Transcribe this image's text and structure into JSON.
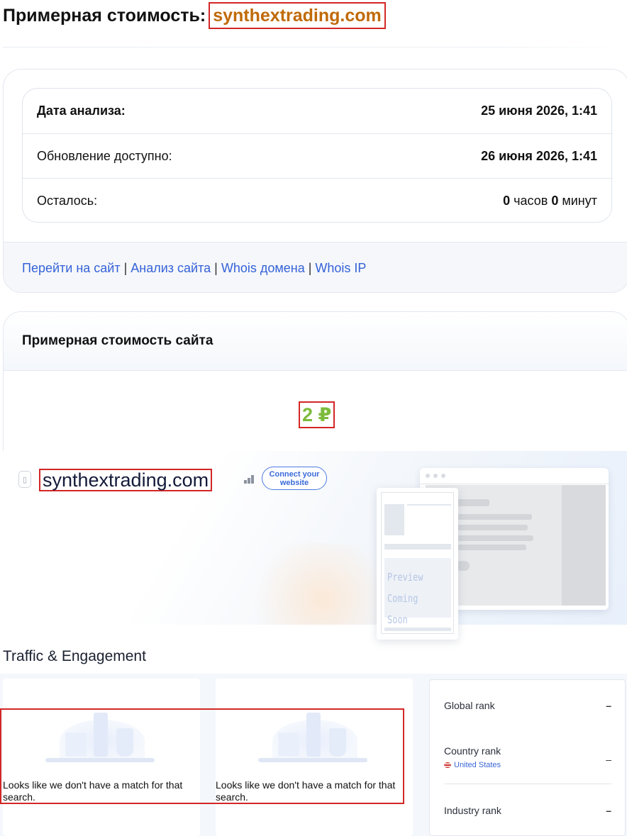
{
  "header": {
    "title": "Примерная стоимость:",
    "domain": "synthextrading.com"
  },
  "analysis": {
    "date_label": "Дата анализа:",
    "date_value": "25 июня 2026, 1:41",
    "update_label": "Обновление доступно:",
    "update_value": "26 июня 2026, 1:41",
    "left_label": "Осталось:",
    "hours": "0",
    "hours_unit": "часов",
    "minutes": "0",
    "minutes_unit": "минут"
  },
  "links": {
    "visit": "Перейти на сайт",
    "analysis": "Анализ сайта",
    "whois_domain": "Whois домена",
    "whois_ip": "Whois IP",
    "separator": "|"
  },
  "value_card": {
    "title": "Примерная стоимость сайта",
    "price": "2 ₽"
  },
  "site_widget": {
    "domain": "synthextrading.com",
    "connect_label": "Connect your website",
    "preview_line1": "Preview",
    "preview_line2": "Coming Soon"
  },
  "traffic": {
    "title": "Traffic & Engagement",
    "empty_message_1": "Looks like we don't have a match for that search.",
    "empty_message_2": "Looks like we don't have a match for that search."
  },
  "ranks": {
    "global_label": "Global rank",
    "global_value": "–",
    "country_label": "Country rank",
    "country_name": "United States",
    "country_value": "–",
    "industry_label": "Industry rank",
    "industry_value": "–"
  },
  "colors": {
    "domain_orange": "#c06a08",
    "link_blue": "#3562d8",
    "price_green": "#7dbb3c",
    "highlight_red": "#d32626"
  }
}
